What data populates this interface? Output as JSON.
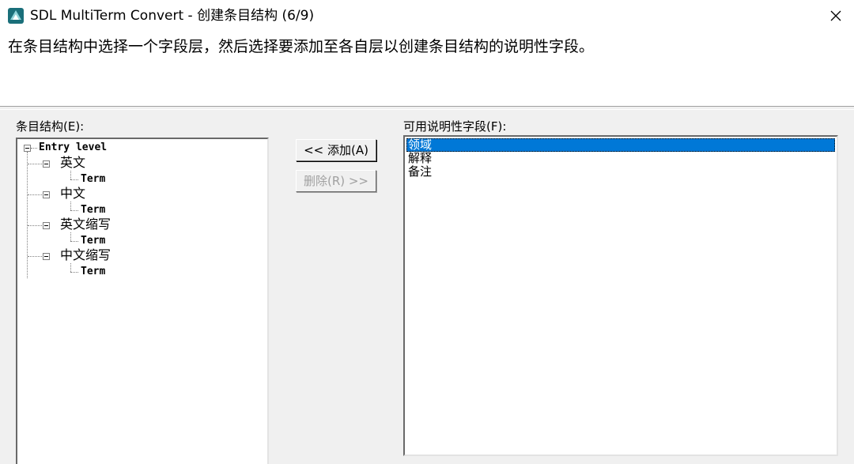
{
  "window": {
    "title": "SDL MultiTerm Convert - 创建条目结构 (6/9)",
    "instruction": "在条目结构中选择一个字段层，然后选择要添加至各自层以创建条目结构的说明性字段。",
    "icon": "sdl-multiterm-icon",
    "close_icon": "close-icon"
  },
  "left_panel": {
    "label": "条目结构(E):",
    "tree": {
      "root": "Entry level",
      "nodes": [
        {
          "label": "英文",
          "child": "Term"
        },
        {
          "label": "中文",
          "child": "Term"
        },
        {
          "label": "英文缩写",
          "child": "Term"
        },
        {
          "label": "中文缩写",
          "child": "Term"
        }
      ]
    }
  },
  "buttons": {
    "add": "<< 添加(A)",
    "remove": "删除(R) >>"
  },
  "right_panel": {
    "label": "可用说明性字段(F):",
    "items": [
      {
        "label": "领域",
        "selected": true
      },
      {
        "label": "解释",
        "selected": false
      },
      {
        "label": "备注",
        "selected": false
      }
    ]
  },
  "colors": {
    "selection": "#0078d7",
    "dialog_bg": "#f0f0f0"
  }
}
